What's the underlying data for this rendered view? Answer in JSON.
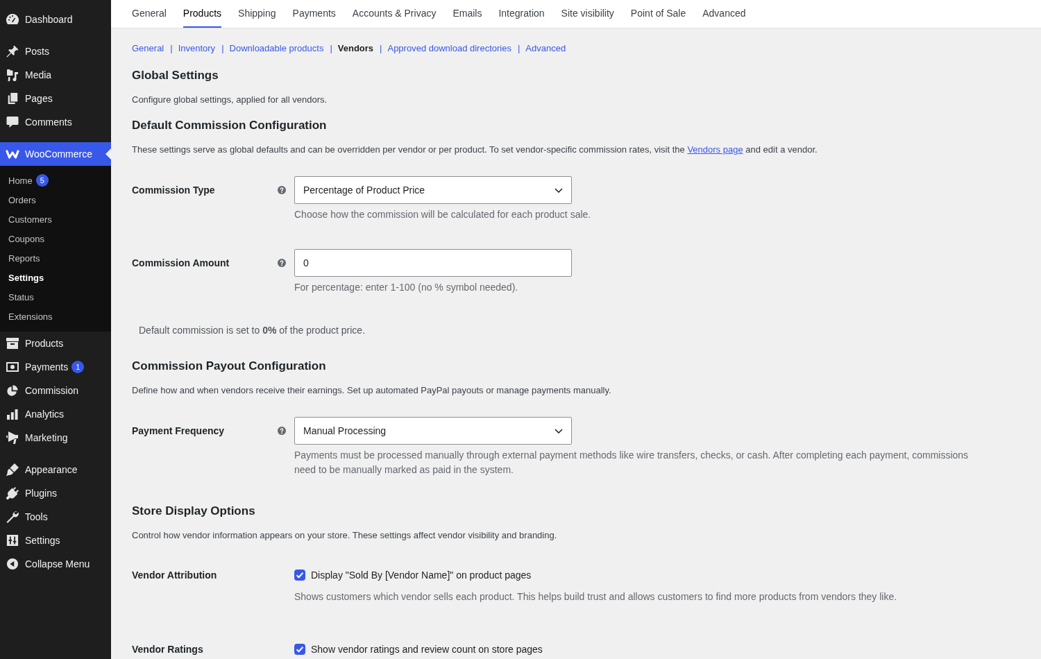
{
  "sidebar": {
    "groups": [
      {
        "items": [
          {
            "label": "Dashboard",
            "selected": false
          }
        ]
      },
      {
        "items": [
          {
            "label": "Posts",
            "selected": false
          },
          {
            "label": "Media",
            "selected": false
          },
          {
            "label": "Pages",
            "selected": false
          },
          {
            "label": "Comments",
            "selected": false
          }
        ]
      },
      {
        "items": [
          {
            "label": "WooCommerce",
            "selected": true,
            "children": [
              {
                "label": "Home",
                "selected": false,
                "badge": "5"
              },
              {
                "label": "Orders",
                "selected": false
              },
              {
                "label": "Customers",
                "selected": false
              },
              {
                "label": "Coupons",
                "selected": false
              },
              {
                "label": "Reports",
                "selected": false
              },
              {
                "label": "Settings",
                "selected": true
              },
              {
                "label": "Status",
                "selected": false
              },
              {
                "label": "Extensions",
                "selected": false
              }
            ]
          },
          {
            "label": "Products",
            "selected": false
          },
          {
            "label": "Payments",
            "selected": false,
            "badge": "1"
          },
          {
            "label": "Commission",
            "selected": false
          },
          {
            "label": "Analytics",
            "selected": false
          },
          {
            "label": "Marketing",
            "selected": false
          }
        ]
      },
      {
        "items": [
          {
            "label": "Appearance",
            "selected": false
          },
          {
            "label": "Plugins",
            "selected": false
          },
          {
            "label": "Tools",
            "selected": false
          },
          {
            "label": "Settings",
            "selected": false
          },
          {
            "label": "Collapse Menu",
            "selected": false
          }
        ]
      }
    ]
  },
  "tabs": [
    {
      "label": "General",
      "selected": false
    },
    {
      "label": "Products",
      "selected": true
    },
    {
      "label": "Shipping",
      "selected": false
    },
    {
      "label": "Payments",
      "selected": false
    },
    {
      "label": "Accounts & Privacy",
      "selected": false
    },
    {
      "label": "Emails",
      "selected": false
    },
    {
      "label": "Integration",
      "selected": false
    },
    {
      "label": "Site visibility",
      "selected": false
    },
    {
      "label": "Point of Sale",
      "selected": false
    },
    {
      "label": "Advanced",
      "selected": false
    }
  ],
  "subnav": {
    "separator": "|",
    "links": [
      {
        "label": "General",
        "selected": false
      },
      {
        "label": "Inventory",
        "selected": false
      },
      {
        "label": "Downloadable products",
        "selected": false
      },
      {
        "label": "Vendors",
        "selected": true
      },
      {
        "label": "Approved download directories",
        "selected": false
      },
      {
        "label": "Advanced",
        "selected": false
      }
    ]
  },
  "sections": [
    {
      "title": "Global Settings",
      "description": "Configure global settings, applied for all vendors."
    },
    {
      "title": "Default Commission Configuration",
      "description": "These settings serve as global defaults and can be overridden per vendor or per product. To set vendor-specific commission rates, visit the ",
      "description_link": "Vendors page",
      "description_end": " and edit a vendor.",
      "fields": [
        {
          "kind": "select",
          "label": "Commission Type",
          "help_icon": true,
          "value": "Percentage of Product Price",
          "hint": "Choose how the commission will be calculated for each product sale."
        },
        {
          "kind": "input",
          "label": "Commission Amount",
          "help_icon": true,
          "value": "0",
          "hint": "For percentage: enter 1-100 (no % symbol needed)."
        }
      ],
      "note": "Default commission is set to **0%** of the product price."
    },
    {
      "title": "Commission Payout Configuration",
      "description": "Define how and when vendors receive their earnings. Set up automated PayPal payouts or manage payments manually.",
      "fields": [
        {
          "kind": "select",
          "label": "Payment Frequency",
          "help_icon": true,
          "value": "Manual Processing",
          "hint": "Payments must be processed manually through external payment methods like wire transfers, checks, or cash. After completing each payment, commissions need to be manually marked as paid in the system."
        }
      ]
    },
    {
      "title": "Store Display Options",
      "description": "Control how vendor information appears on your store. These settings affect vendor visibility and branding.",
      "fields": [
        {
          "kind": "checkbox",
          "label": "Vendor Attribution",
          "help_icon": false,
          "checked": true,
          "option": "Display \"Sold By [Vendor Name]\" on product pages",
          "hint": "Shows customers which vendor sells each product. This helps build trust and allows customers to find more products from vendors they like."
        },
        {
          "kind": "checkbox",
          "label": "Vendor Ratings",
          "help_icon": false,
          "checked": true,
          "option": "Show vendor ratings and review count on store pages"
        }
      ]
    }
  ]
}
